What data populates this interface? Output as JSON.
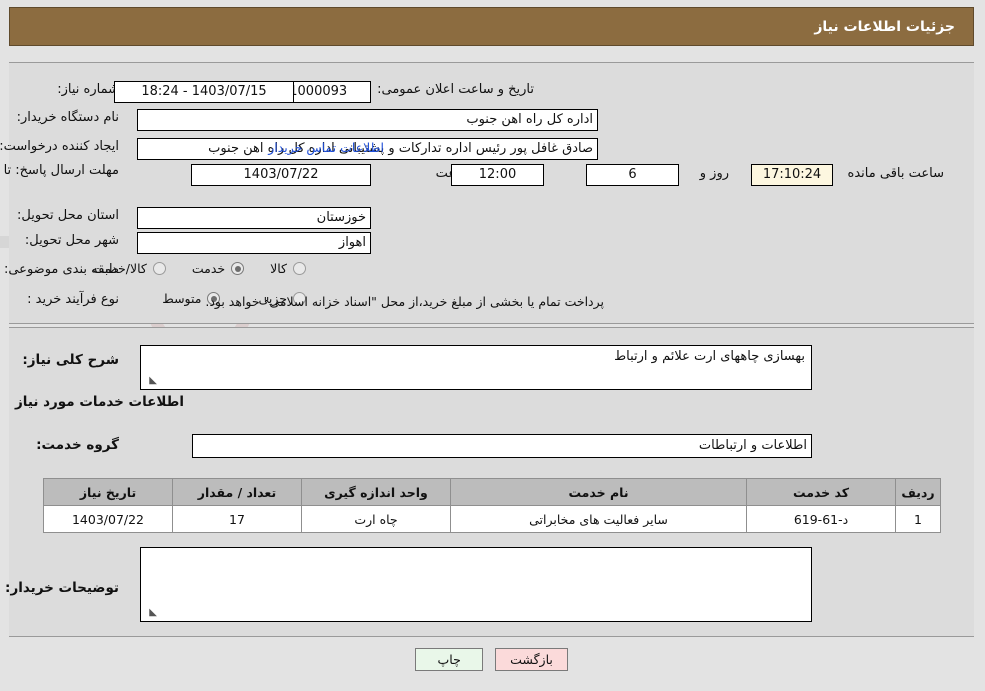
{
  "header": {
    "title": "جزئیات اطلاعات نیاز"
  },
  "form": {
    "need_number_label": "شماره نیاز:",
    "need_number_value": "1103001251000093",
    "public_announce_label": "تاریخ و ساعت اعلان عمومی:",
    "public_announce_value": "1403/07/15 - 18:24",
    "buyer_org_label": "نام دستگاه خریدار:",
    "buyer_org_value": "اداره کل راه اهن جنوب",
    "requester_label": "ایجاد کننده درخواست:",
    "requester_value": "صادق غافل پور رئیس اداره تدارکات و پشتیبانی اداره کل راه اهن جنوب",
    "buyer_contact_link": "اطلاعات تماس خریدار",
    "deadline_label": "مهلت ارسال پاسخ: تا تاریخ:",
    "deadline_date": "1403/07/22",
    "hour_label": "ساعت",
    "deadline_time": "12:00",
    "days_remaining": "6",
    "days_unit_label": "روز و",
    "countdown": "17:10:24",
    "remaining_suffix_label": "ساعت باقی مانده",
    "province_label": "استان محل تحویل:",
    "province_value": "خوزستان",
    "city_label": "شهر محل تحویل:",
    "city_value": "اهواز",
    "category_label": "طبقه بندی موضوعی:",
    "category_options": [
      "کالا",
      "خدمت",
      "کالا/خدمت"
    ],
    "category_selected": "خدمت",
    "process_label": "نوع فرآیند خرید :",
    "process_options": [
      "جزیی",
      "متوسط"
    ],
    "process_selected": "متوسط",
    "payment_note": "پرداخت تمام یا بخشی از مبلغ خرید،از محل \"اسناد خزانه اسلامی\" خواهد بود.",
    "general_desc_label": "شرح کلی نیاز:",
    "general_desc_value": "بهسازی چاههای ارت علائم و ارتباط",
    "services_section_title": "اطلاعات خدمات مورد نیاز",
    "service_group_label": "گروه خدمت:",
    "service_group_value": "اطلاعات و ارتباطات",
    "buyer_comments_label": "توضیحات خریدار:",
    "buyer_comments_value": ""
  },
  "table": {
    "headers": [
      "ردیف",
      "کد خدمت",
      "نام خدمت",
      "واحد اندازه گیری",
      "تعداد / مقدار",
      "تاریخ نیاز"
    ],
    "rows": [
      {
        "index": "1",
        "code": "د-61-619",
        "name": "سایر فعالیت های مخابراتی",
        "unit": "چاه ارت",
        "quantity": "17",
        "date": "1403/07/22"
      }
    ]
  },
  "buttons": {
    "print": "چاپ",
    "back": "بازگشت"
  },
  "watermark": {
    "text": "AnaTender"
  },
  "colors": {
    "titlebar": "#8c6c40",
    "panel": "#dcdcdc",
    "link": "#1f4fd8",
    "print_btn": "#e9f7e9",
    "back_btn": "#fbdada",
    "table_header": "#bcbcbc"
  }
}
